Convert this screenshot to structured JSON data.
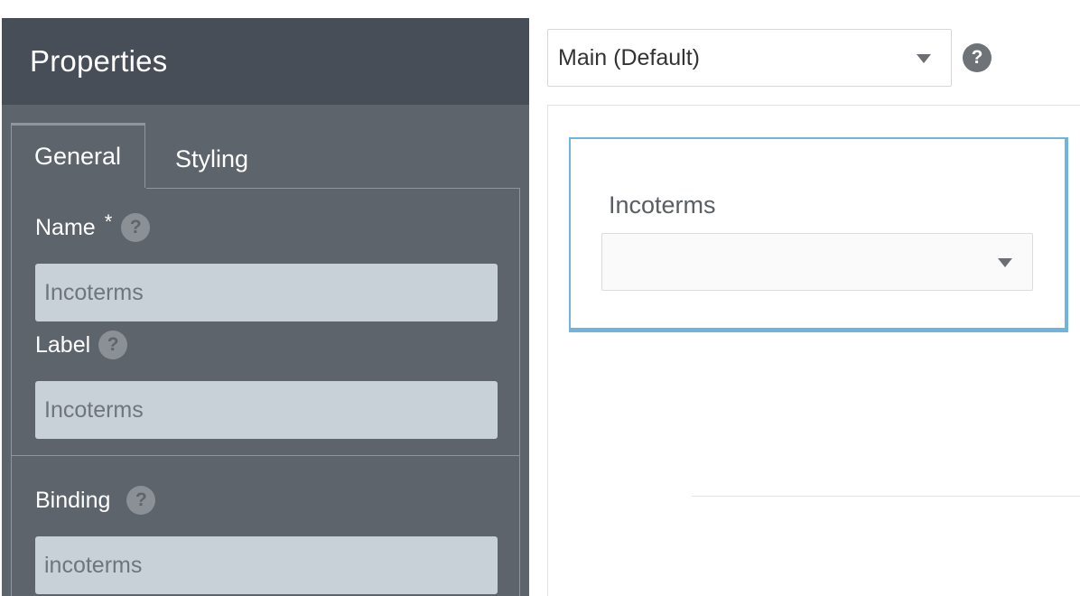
{
  "properties_panel": {
    "title": "Properties",
    "tabs": [
      {
        "label": "General",
        "active": true
      },
      {
        "label": "Styling",
        "active": false
      }
    ],
    "fields": {
      "name": {
        "label": "Name",
        "required_marker": "*",
        "value": "Incoterms"
      },
      "label": {
        "label": "Label",
        "value": "Incoterms"
      },
      "binding": {
        "label": "Binding",
        "value": "incoterms"
      }
    },
    "help_glyph": "?"
  },
  "view_selector": {
    "selected": "Main (Default)",
    "help_glyph": "?"
  },
  "preview": {
    "field_label": "Incoterms",
    "dropdown_value": ""
  },
  "colors": {
    "panel_header": "#474e57",
    "panel_body": "#5d646c",
    "input_bg": "#c8d0d8",
    "selection_accent": "#6fb3de"
  },
  "icons": {
    "help": "help-icon",
    "dropdown": "chevron-down-icon"
  }
}
